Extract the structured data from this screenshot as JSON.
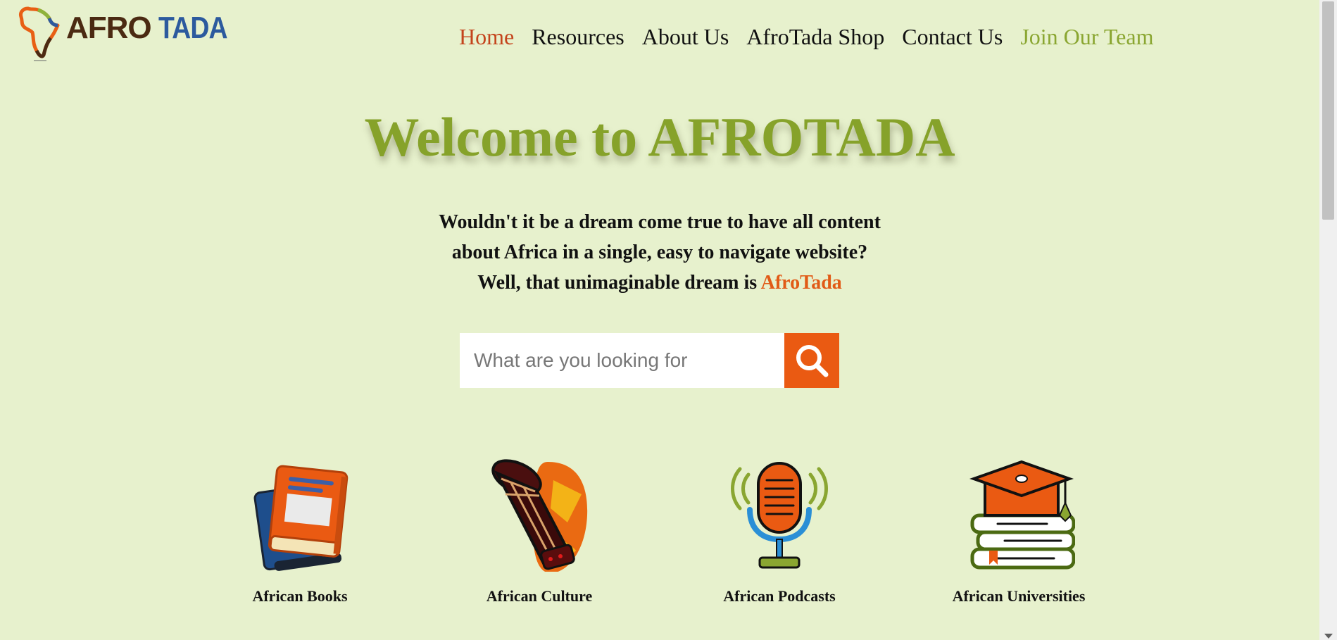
{
  "logo": {
    "part1": "AFRO",
    "part2": "TADA"
  },
  "nav": {
    "home": "Home",
    "resources": "Resources",
    "about": "About Us",
    "shop": "AfroTada Shop",
    "contact": "Contact Us",
    "join": "Join Our Team"
  },
  "hero": {
    "title": "Welcome to AFROTADA",
    "line1": "Wouldn't it be a dream come true to have all content",
    "line2": "about Africa in a single, easy to navigate website?",
    "line3_prefix": "Well, that unimaginable dream is ",
    "line3_brand": "AfroTada"
  },
  "search": {
    "placeholder": "What are you looking for",
    "icon": "search-icon"
  },
  "categories": [
    {
      "label": "African Books",
      "icon": "books-icon"
    },
    {
      "label": "African Culture",
      "icon": "drum-mask-icon"
    },
    {
      "label": "African Podcasts",
      "icon": "microphone-icon"
    },
    {
      "label": "African Universities",
      "icon": "graduation-cap-books-icon"
    }
  ],
  "colors": {
    "background": "#e7f1cd",
    "accent_orange": "#e15a16",
    "accent_green": "#86a22a",
    "nav_active": "#c4441c"
  }
}
